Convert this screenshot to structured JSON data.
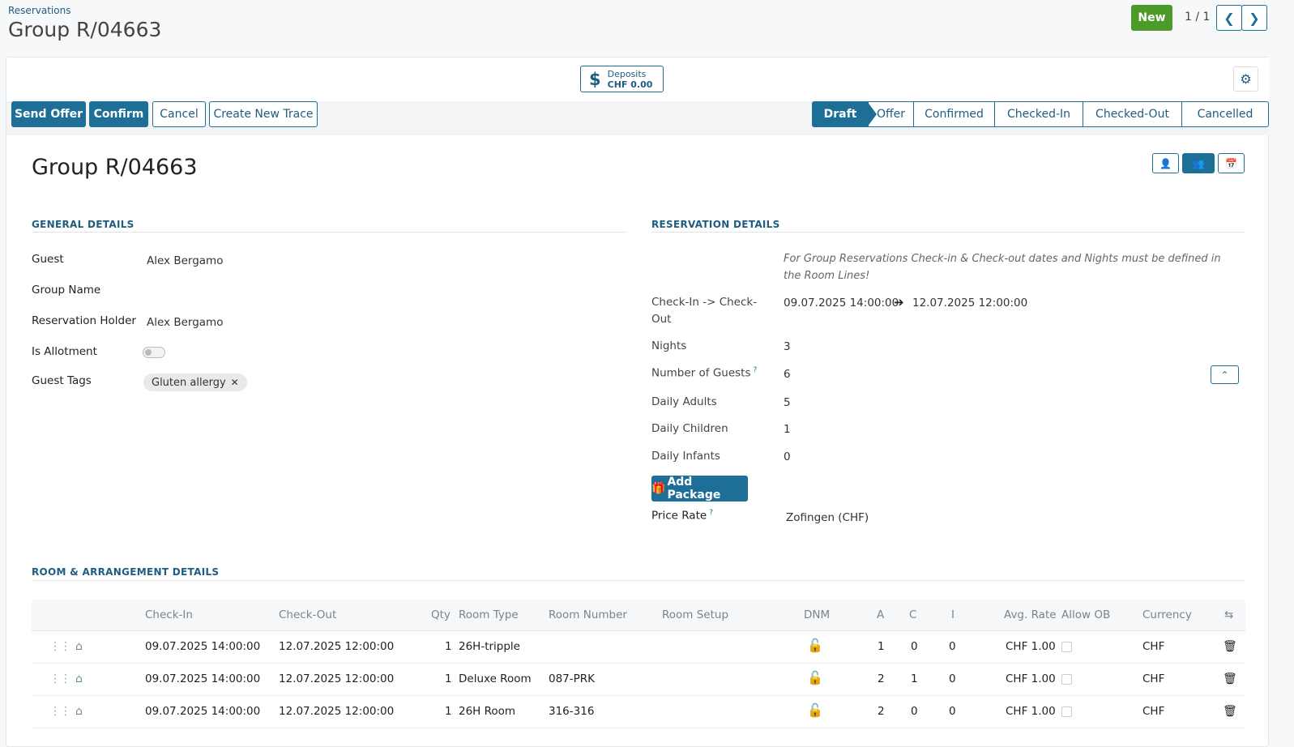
{
  "header": {
    "breadcrumb": "Reservations",
    "title": "Group R/04663",
    "new_label": "New",
    "pager": "1 / 1"
  },
  "buttonbox": {
    "deposits_label": "Deposits",
    "deposits_amount": "CHF 0.00"
  },
  "actions": {
    "send_offer": "Send Offer",
    "confirm": "Confirm",
    "cancel": "Cancel",
    "create_trace": "Create New Trace"
  },
  "statusbar": {
    "steps": [
      "Draft",
      "Offer",
      "Confirmed",
      "Checked-In",
      "Checked-Out",
      "Cancelled"
    ],
    "active": "Draft"
  },
  "form": {
    "title": "Group R/04663"
  },
  "general": {
    "section_title": "GENERAL DETAILS",
    "guest_label": "Guest",
    "guest_value": "Alex Bergamo",
    "group_name_label": "Group Name",
    "holder_label": "Reservation Holder",
    "holder_value": "Alex Bergamo",
    "allotment_label": "Is Allotment",
    "tags_label": "Guest Tags",
    "tag_value": "Gluten allergy"
  },
  "reservation": {
    "section_title": "RESERVATION DETAILS",
    "note": "For Group Reservations Check-in & Check-out dates and Nights must be defined in the Room Lines!",
    "checkin_label": "Check-In -> Check-Out",
    "checkin_value": "09.07.2025 14:00:00",
    "checkout_value": "12.07.2025 12:00:00",
    "nights_label": "Nights",
    "nights_value": "3",
    "guests_label": "Number of Guests",
    "guests_value": "6",
    "adults_label": "Daily Adults",
    "adults_value": "5",
    "children_label": "Daily Children",
    "children_value": "1",
    "infants_label": "Daily Infants",
    "infants_value": "0",
    "add_package": "Add Package",
    "price_rate_label": "Price Rate",
    "price_rate_value": "Zofingen (CHF)"
  },
  "rooms": {
    "section_title": "ROOM & ARRANGEMENT DETAILS",
    "columns": {
      "checkin": "Check-In",
      "checkout": "Check-Out",
      "qty": "Qty",
      "room_type": "Room Type",
      "room_number": "Room Number",
      "room_setup": "Room Setup",
      "dnm": "DNM",
      "a": "A",
      "c": "C",
      "i": "I",
      "avg_rate": "Avg. Rate",
      "allow_ob": "Allow OB",
      "currency": "Currency"
    },
    "rows": [
      {
        "checkin": "09.07.2025 14:00:00",
        "checkout": "12.07.2025 12:00:00",
        "qty": "1",
        "room_type": "26H-tripple",
        "room_number": "",
        "a": "1",
        "c": "0",
        "i": "0",
        "avg_rate": "CHF 1.00",
        "currency": "CHF"
      },
      {
        "checkin": "09.07.2025 14:00:00",
        "checkout": "12.07.2025 12:00:00",
        "qty": "1",
        "room_type": "Deluxe Room",
        "room_number": "087-PRK",
        "a": "2",
        "c": "1",
        "i": "0",
        "avg_rate": "CHF 1.00",
        "currency": "CHF"
      },
      {
        "checkin": "09.07.2025 14:00:00",
        "checkout": "12.07.2025 12:00:00",
        "qty": "1",
        "room_type": "26H Room",
        "room_number": "316-316",
        "a": "2",
        "c": "0",
        "i": "0",
        "avg_rate": "CHF 1.00",
        "currency": "CHF"
      }
    ]
  }
}
